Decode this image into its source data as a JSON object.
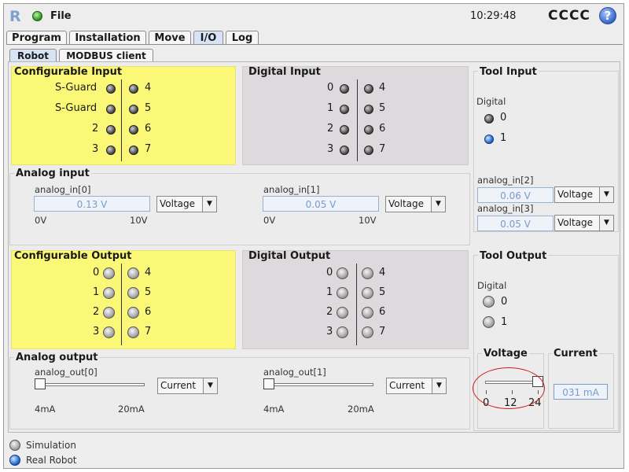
{
  "app": {
    "logo": "R",
    "file_menu": "File",
    "clock": "10:29:48",
    "robot_name": "CCCC",
    "help": "?"
  },
  "tabs": [
    "Program",
    "Installation",
    "Move",
    "I/O",
    "Log"
  ],
  "active_tab": "I/O",
  "subtabs": [
    "Robot",
    "MODBUS client"
  ],
  "active_subtab": "Robot",
  "configurable_input": {
    "title": "Configurable Input",
    "left": [
      "S-Guard",
      "S-Guard",
      "2",
      "3"
    ],
    "right": [
      "4",
      "5",
      "6",
      "7"
    ]
  },
  "digital_input": {
    "title": "Digital Input",
    "left": [
      "0",
      "1",
      "2",
      "3"
    ],
    "right": [
      "4",
      "5",
      "6",
      "7"
    ]
  },
  "tool_input": {
    "title": "Tool Input",
    "digital_label": "Digital",
    "pins": [
      "0",
      "1"
    ],
    "active_pin": "1",
    "analog": [
      {
        "label": "analog_in[2]",
        "value": "0.06 V",
        "mode": "Voltage"
      },
      {
        "label": "analog_in[3]",
        "value": "0.05 V",
        "mode": "Voltage"
      }
    ]
  },
  "analog_input": {
    "title": "Analog input",
    "channels": [
      {
        "label": "analog_in[0]",
        "value": "0.13 V",
        "mode": "Voltage",
        "min": "0V",
        "max": "10V"
      },
      {
        "label": "analog_in[1]",
        "value": "0.05 V",
        "mode": "Voltage",
        "min": "0V",
        "max": "10V"
      }
    ]
  },
  "configurable_output": {
    "title": "Configurable Output",
    "left": [
      "0",
      "1",
      "2",
      "3"
    ],
    "right": [
      "4",
      "5",
      "6",
      "7"
    ]
  },
  "digital_output": {
    "title": "Digital Output",
    "left": [
      "0",
      "1",
      "2",
      "3"
    ],
    "right": [
      "4",
      "5",
      "6",
      "7"
    ]
  },
  "tool_output": {
    "title": "Tool Output",
    "digital_label": "Digital",
    "pins": [
      "0",
      "1"
    ],
    "voltage": {
      "title": "Voltage",
      "ticks": [
        "0",
        "12",
        "24"
      ],
      "value": 24
    },
    "current": {
      "title": "Current",
      "value": "031 mA"
    }
  },
  "analog_output": {
    "title": "Analog output",
    "channels": [
      {
        "label": "analog_out[0]",
        "mode": "Current",
        "min": "4mA",
        "max": "20mA",
        "level": 0
      },
      {
        "label": "analog_out[1]",
        "mode": "Current",
        "min": "4mA",
        "max": "20mA",
        "level": 0
      }
    ]
  },
  "status": {
    "simulation": "Simulation",
    "real_robot": "Real Robot"
  },
  "colors": {
    "configurable_bg": "#fbf878",
    "digital_bg": "#ddd9dc",
    "highlight": "#d01e1e",
    "tab_active": "#d7e4f6"
  }
}
